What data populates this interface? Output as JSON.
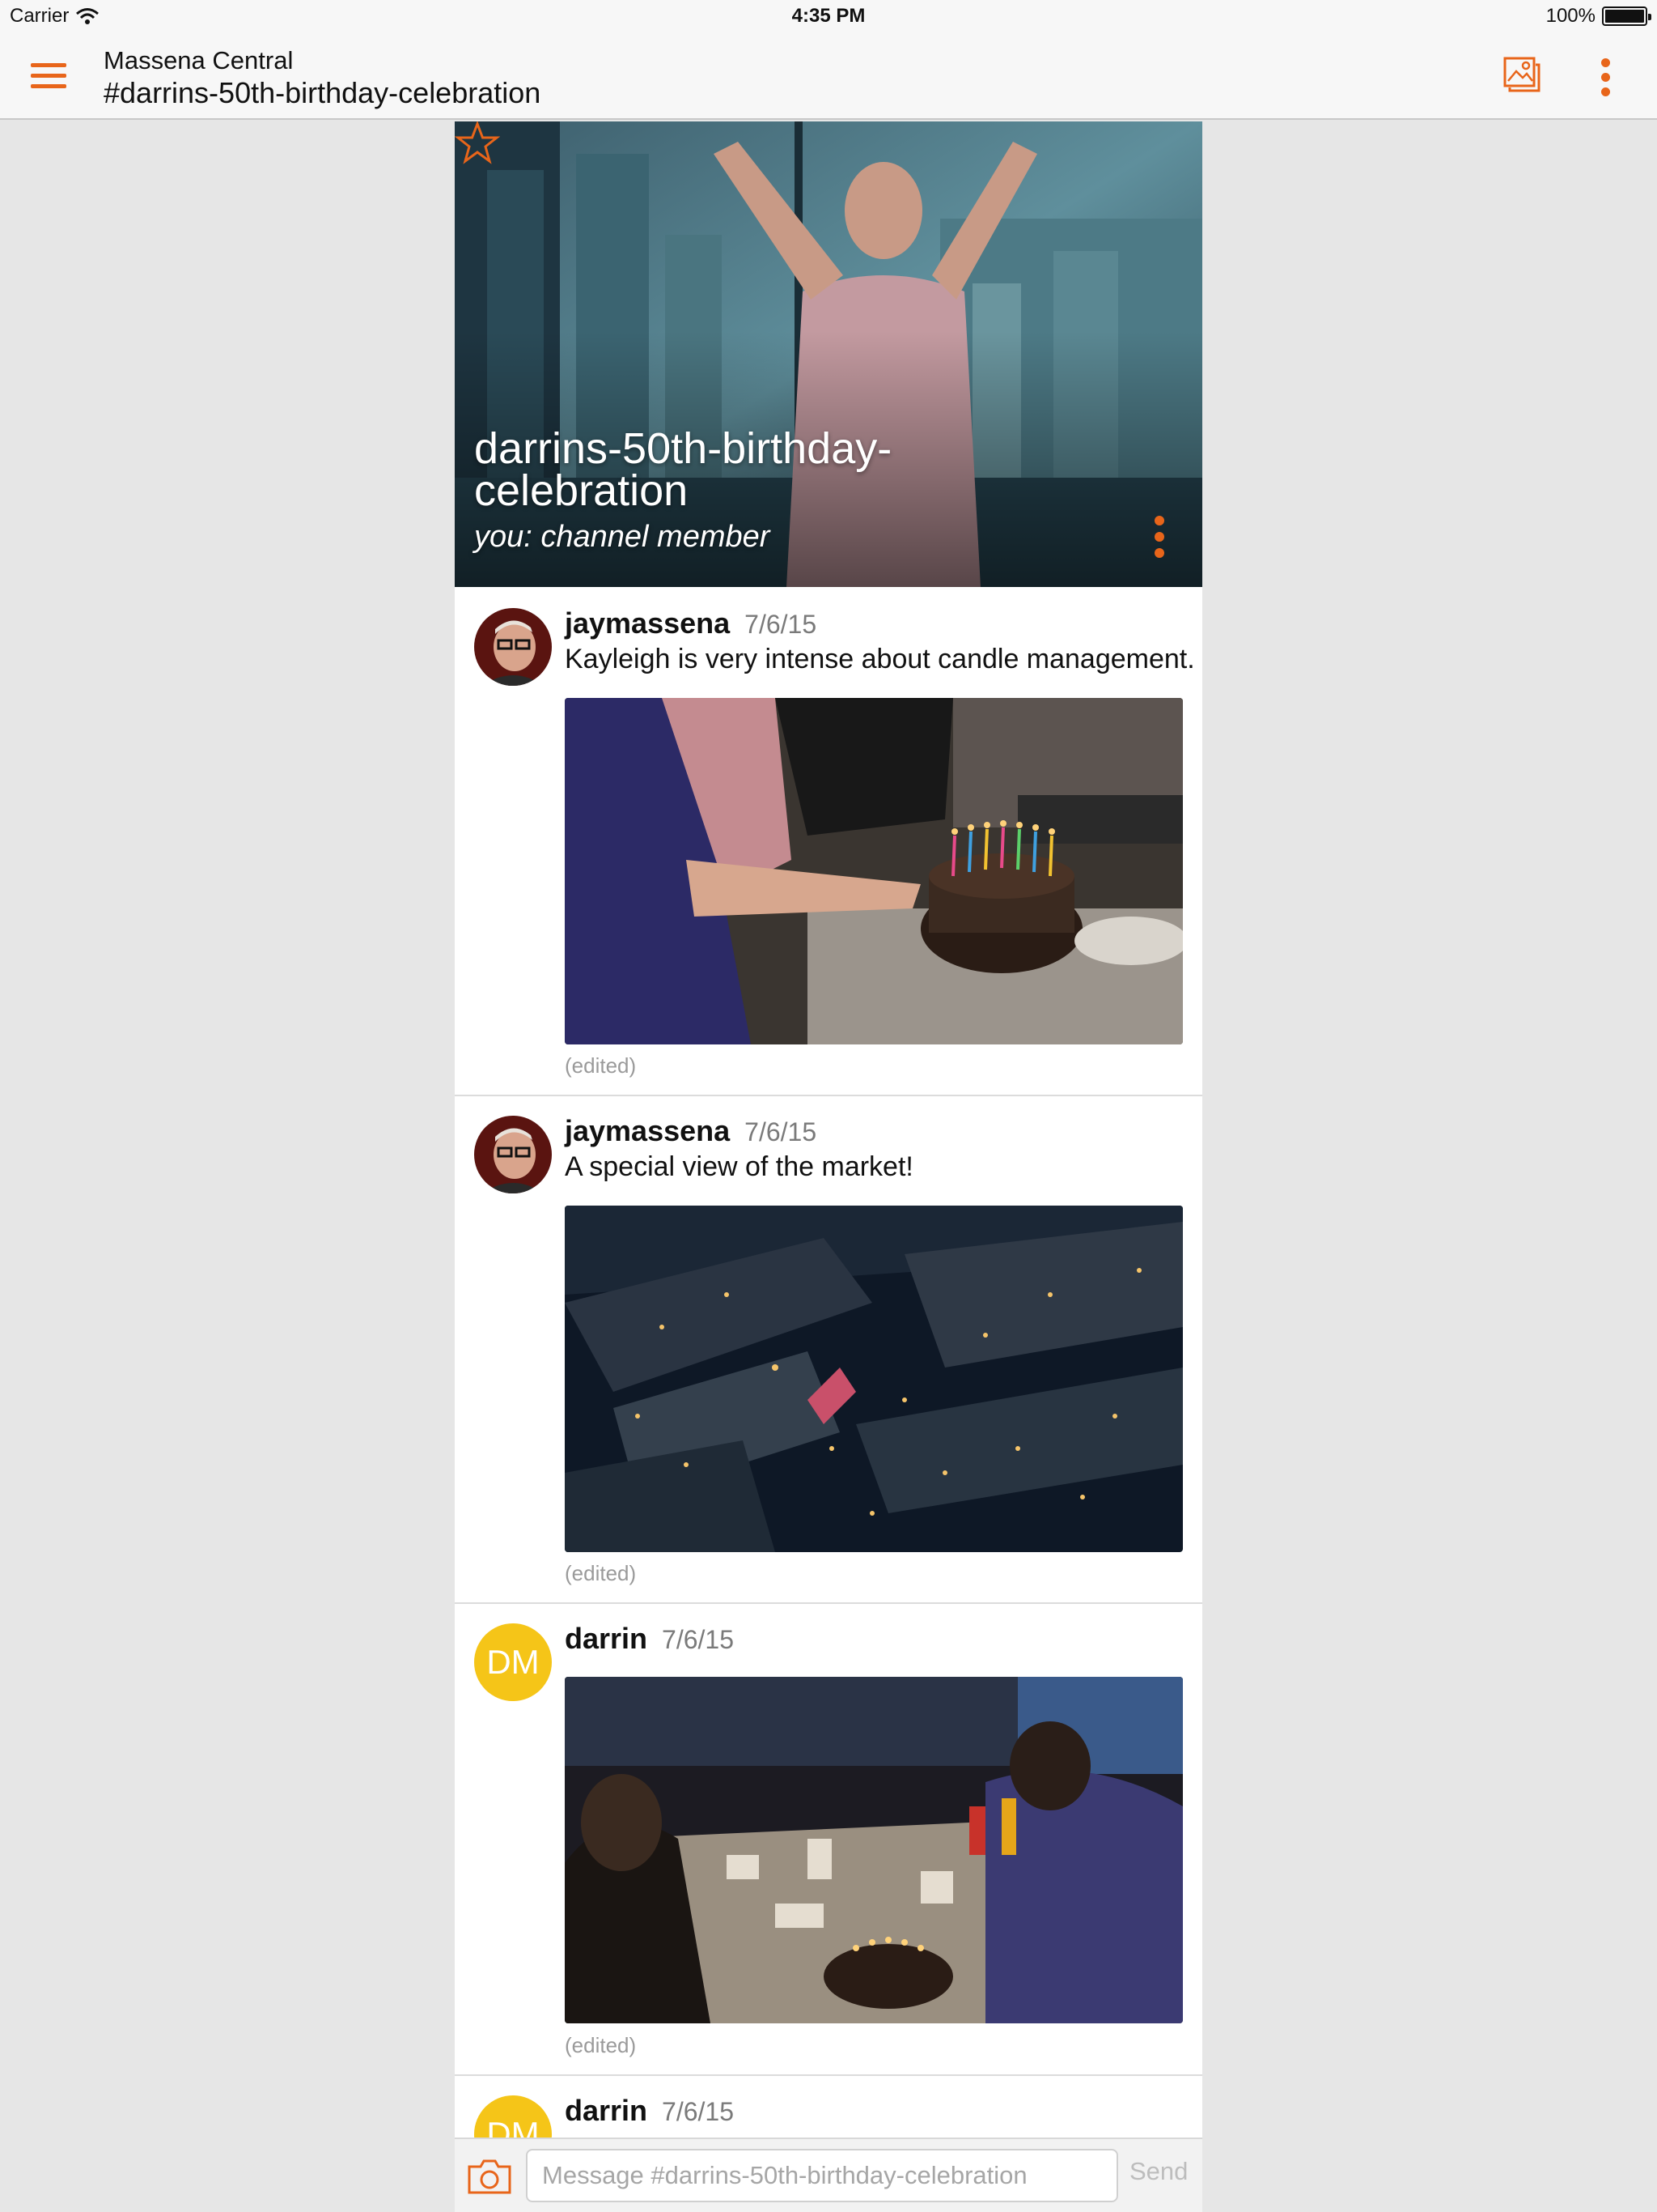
{
  "status_bar": {
    "carrier": "Carrier",
    "time": "4:35 PM",
    "battery": "100%"
  },
  "nav": {
    "team": "Massena Central",
    "channel": "#darrins-50th-birthday-celebration"
  },
  "hero": {
    "title": "darrins-50th-birthday-celebration",
    "subtitle": "you: channel member"
  },
  "messages": [
    {
      "user": "jaymassena",
      "date": "7/6/15",
      "text": "Kayleigh is very intense about candle management.",
      "edited": "(edited)"
    },
    {
      "user": "jaymassena",
      "date": "7/6/15",
      "text": "A special view of the market!",
      "edited": "(edited)"
    },
    {
      "user": "darrin",
      "avatar_initials": "DM",
      "date": "7/6/15",
      "edited": "(edited)"
    },
    {
      "user": "darrin",
      "avatar_initials": "DM",
      "date": "7/6/15"
    }
  ],
  "composer": {
    "placeholder": "Message #darrins-50th-birthday-celebration",
    "send_label": "Send"
  },
  "colors": {
    "accent": "#e8651a",
    "avatar_dm": "#f5c518",
    "background": "#e6e6e6"
  },
  "icons": {
    "menu": "hamburger-menu-icon",
    "gallery": "photo-gallery-icon",
    "more": "vertical-ellipsis-icon",
    "star": "star-outline-icon",
    "camera": "camera-icon"
  }
}
